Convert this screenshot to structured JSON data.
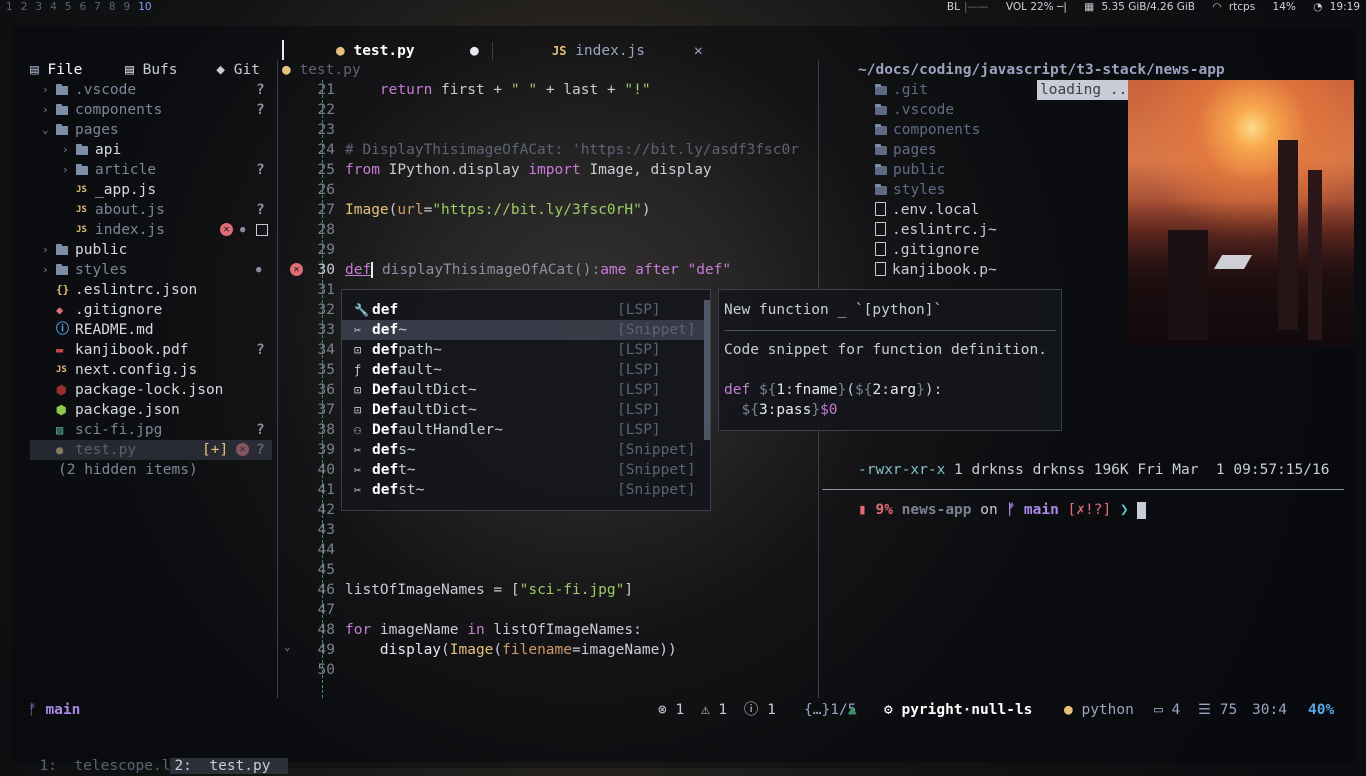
{
  "topbar": {
    "workspaces": [
      "1",
      "2",
      "3",
      "4",
      "5",
      "6",
      "7",
      "8",
      "9",
      "10"
    ],
    "active_workspace": "10",
    "keyboard": "BL",
    "volume": "VOL 22% ─|",
    "memory": "5.35 GiB/4.26 GiB",
    "network": "rtcps",
    "battery": "14%",
    "clock": "19:19"
  },
  "tabs": [
    {
      "name": "test.py",
      "modified_icon": "●"
    },
    {
      "name": "index.js",
      "close_icon": "✕"
    }
  ],
  "breadcrumb": "test.py",
  "sidebar": {
    "tabs": [
      "File",
      "Bufs",
      "Git"
    ],
    "tree": [
      {
        "name": ".vscode",
        "type": "folder",
        "indent": 0,
        "chev": "›",
        "status": "?",
        "color": "#7d8598"
      },
      {
        "name": "components",
        "type": "folder",
        "indent": 0,
        "chev": "›",
        "status": "?",
        "color": "#7d8598"
      },
      {
        "name": "pages",
        "type": "folder",
        "indent": 0,
        "chev": "⌄",
        "status": "",
        "color": "#7d8598"
      },
      {
        "name": "api",
        "type": "folder",
        "indent": 1,
        "chev": "›",
        "status": "",
        "color": "#d6d9e0"
      },
      {
        "name": "article",
        "type": "folder",
        "indent": 1,
        "chev": "›",
        "status": "?",
        "color": "#7d8598"
      },
      {
        "name": "_app.js",
        "type": "js",
        "indent": 1,
        "chev": "",
        "status": "",
        "color": "#d6d9e0"
      },
      {
        "name": "about.js",
        "type": "js",
        "indent": 1,
        "chev": "",
        "status": "?",
        "color": "#7d8598"
      },
      {
        "name": "index.js",
        "type": "js",
        "indent": 1,
        "chev": "",
        "status": "",
        "color": "#7d8598"
      },
      {
        "name": "public",
        "type": "folder",
        "indent": 0,
        "chev": "›",
        "status": "",
        "color": "#d6d9e0"
      },
      {
        "name": "styles",
        "type": "folder",
        "indent": 0,
        "chev": "›",
        "status": "●",
        "color": "#7d8598"
      },
      {
        "name": ".eslintrc.json",
        "type": "json",
        "indent": 0,
        "chev": "",
        "status": "",
        "color": "#d6d9e0"
      },
      {
        "name": ".gitignore",
        "type": "git",
        "indent": 0,
        "chev": "",
        "status": "",
        "color": "#d6d9e0"
      },
      {
        "name": "README.md",
        "type": "info",
        "indent": 0,
        "chev": "",
        "status": "",
        "color": "#d6d9e0"
      },
      {
        "name": "kanjibook.pdf",
        "type": "pdf",
        "indent": 0,
        "chev": "",
        "status": "?",
        "color": "#d6d9e0"
      },
      {
        "name": "next.config.js",
        "type": "js",
        "indent": 0,
        "chev": "",
        "status": "",
        "color": "#d6d9e0"
      },
      {
        "name": "package-lock.json",
        "type": "lock",
        "indent": 0,
        "chev": "",
        "status": "",
        "color": "#d6d9e0"
      },
      {
        "name": "package.json",
        "type": "node",
        "indent": 0,
        "chev": "",
        "status": "",
        "color": "#d6d9e0"
      },
      {
        "name": "sci-fi.jpg",
        "type": "img",
        "indent": 0,
        "chev": "",
        "status": "?",
        "color": "#7d8598"
      },
      {
        "name": "test.py",
        "type": "py",
        "indent": 0,
        "chev": "",
        "status": "?",
        "color": "#7d8598"
      }
    ],
    "modified_tag": "[+]",
    "hidden_items": "(2 hidden items)"
  },
  "editor": {
    "lines": [
      {
        "n": "21",
        "html": "    <span class='kw'>return</span> first + <span class='str'>\" \"</span> + last + <span class='str'>\"!\"</span>"
      },
      {
        "n": "22",
        "html": ""
      },
      {
        "n": "23",
        "html": ""
      },
      {
        "n": "24",
        "html": "<span class='cm'># DisplayThisimageOfACat: 'https://bit.ly/asdf3fsc0r</span>"
      },
      {
        "n": "25",
        "html": "<span class='kw'>from</span> IPython.display <span class='kw'>import</span> Image, display"
      },
      {
        "n": "26",
        "html": ""
      },
      {
        "n": "27",
        "html": "<span class='cls'>Image</span>(<span class='arg'>url</span>=<span class='str'>\"https://bit.ly/3fsc0rH\"</span>)"
      },
      {
        "n": "28",
        "html": ""
      },
      {
        "n": "29",
        "html": ""
      },
      {
        "n": "30",
        "html": "<span class='kw' style='text-decoration:underline'>def</span><span style='border-left:2px solid #e6e9ef'></span> <span style='color:#8a90a0'>displayThisimageOfACat():</span><span class='kw'>ame after \"def\"</span>"
      },
      {
        "n": "31",
        "html": ""
      },
      {
        "n": "32",
        "html": ""
      },
      {
        "n": "33",
        "html": ""
      },
      {
        "n": "34",
        "html": ""
      },
      {
        "n": "35",
        "html": ""
      },
      {
        "n": "36",
        "html": ""
      },
      {
        "n": "37",
        "html": ""
      },
      {
        "n": "38",
        "html": ""
      },
      {
        "n": "39",
        "html": ""
      },
      {
        "n": "40",
        "html": ""
      },
      {
        "n": "41",
        "html": ""
      },
      {
        "n": "42",
        "html": ""
      },
      {
        "n": "43",
        "html": ""
      },
      {
        "n": "44",
        "html": ""
      },
      {
        "n": "45",
        "html": ""
      },
      {
        "n": "46",
        "html": "listOfImageNames = [<span class='str'>\"sci-fi.jpg\"</span>]"
      },
      {
        "n": "47",
        "html": ""
      },
      {
        "n": "48",
        "html": "<span class='kw'>for</span> imageName <span class='kw'>in</span> listOfImageNames:"
      },
      {
        "n": "49",
        "html": "    <span class='fn'>display</span>(<span class='cls'>Image</span>(<span class='arg'>filename</span>=imageName))"
      },
      {
        "n": "50",
        "html": ""
      }
    ]
  },
  "completion": {
    "items": [
      {
        "icon": "🔧",
        "bold": "def",
        "rest": "",
        "source": "[LSP]"
      },
      {
        "icon": "✂",
        "bold": "def",
        "rest": "~",
        "source": "[Snippet]"
      },
      {
        "icon": "⊡",
        "bold": "def",
        "rest": "path~",
        "source": "[LSP]"
      },
      {
        "icon": "ƒ",
        "bold": "def",
        "rest": "ault~",
        "source": "[LSP]"
      },
      {
        "icon": "⊡",
        "bold": "Def",
        "rest": "aultDict~",
        "source": "[LSP]"
      },
      {
        "icon": "⊡",
        "bold": "Def",
        "rest": "aultDict~",
        "source": "[LSP]"
      },
      {
        "icon": "⚇",
        "bold": "Def",
        "rest": "aultHandler~",
        "source": "[LSP]"
      },
      {
        "icon": "✂",
        "bold": "def",
        "rest": "s~",
        "source": "[Snippet]"
      },
      {
        "icon": "✂",
        "bold": "def",
        "rest": "t~",
        "source": "[Snippet]"
      },
      {
        "icon": "✂",
        "bold": "def",
        "rest": "st~",
        "source": "[Snippet]"
      }
    ]
  },
  "docs": {
    "title": "New function _ `[python]`",
    "description": "Code snippet for function definition."
  },
  "right_pane": {
    "path": "~/docs/coding/javascript/t3-stack/news-app",
    "loading": "loading ...",
    "entries": [
      {
        "name": ".git",
        "type": "folder"
      },
      {
        "name": ".vscode",
        "type": "folder"
      },
      {
        "name": "components",
        "type": "folder"
      },
      {
        "name": "pages",
        "type": "folder"
      },
      {
        "name": "public",
        "type": "folder"
      },
      {
        "name": "styles",
        "type": "folder"
      },
      {
        "name": ".env.local",
        "type": "file"
      },
      {
        "name": ".eslintrc.j~",
        "type": "file"
      },
      {
        "name": ".gitignore",
        "type": "file"
      },
      {
        "name": "kanjibook.p~",
        "type": "file"
      }
    ],
    "file_info": "-rwxr-xr-x 1 drknss drknss 196K Fri Mar  1 09:57:15/16",
    "prompt": {
      "battery": "9%",
      "dir": "news-app",
      "on": "on",
      "branch": "main",
      "flags": "[✗!?]",
      "symbol": "❯"
    }
  },
  "statusline": {
    "branch": "main",
    "errors": "1",
    "warnings": "1",
    "info": "1",
    "scope": "{…}1/5",
    "lsp": "pyright·null-ls",
    "filetype": "python",
    "indent": "4",
    "lines": "75",
    "position": "30:4",
    "percent": "40%"
  },
  "cmdline": {
    "buf1_num": "1:",
    "buf1_name": "telescope.l",
    "buf2_num": "2:",
    "buf2_name": "test.py"
  }
}
